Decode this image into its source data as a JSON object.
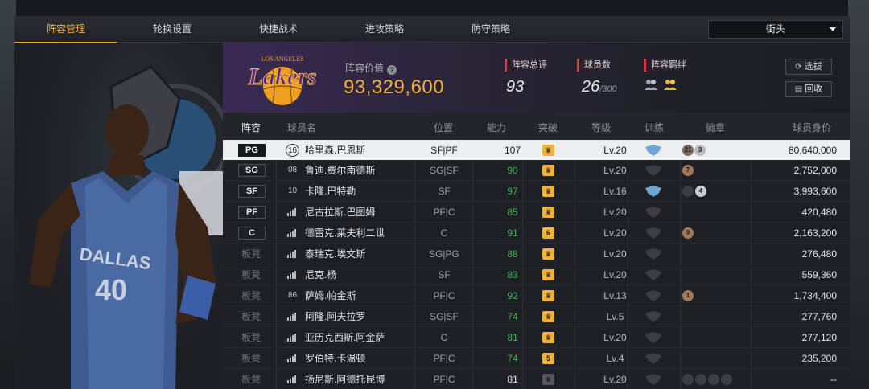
{
  "tabs": [
    {
      "label": "阵容管理",
      "active": true
    },
    {
      "label": "轮换设置",
      "active": false
    },
    {
      "label": "快捷战术",
      "active": false
    },
    {
      "label": "进攻策略",
      "active": false
    },
    {
      "label": "防守策略",
      "active": false
    }
  ],
  "dropdown": {
    "value": "街头"
  },
  "team": {
    "value_label": "阵容价值",
    "value": "93,329,600",
    "rating_label": "阵容总评",
    "rating": "93",
    "players_label": "球员数",
    "players": "26",
    "players_max": "/300",
    "bond_label": "阵容羁绊",
    "buttons": {
      "select": "选拔",
      "recycle": "回收"
    }
  },
  "columns": [
    "阵容",
    "球员名",
    "位置",
    "能力",
    "突破",
    "等级",
    "训练",
    "徽章",
    "球员身价"
  ],
  "rows": [
    {
      "slot": "PG",
      "number": "16",
      "name": "哈里森.巴恩斯",
      "position": "SF|PF",
      "ability": "107",
      "breakthrough": "",
      "level": "Lv.20",
      "salary": "80,640,000",
      "selected": true
    },
    {
      "slot": "SG",
      "number": "08",
      "name": "鲁迪.费尔南德斯",
      "position": "SG|SF",
      "ability": "90",
      "breakthrough": "",
      "level": "Lv.20",
      "salary": "2,752,000"
    },
    {
      "slot": "SF",
      "number": "10",
      "name": "卡隆.巴特勒",
      "position": "SF",
      "ability": "97",
      "breakthrough": "",
      "level": "Lv.16",
      "salary": "3,993,600"
    },
    {
      "slot": "PF",
      "number": "",
      "name": "尼古拉斯.巴图姆",
      "position": "PF|C",
      "ability": "85",
      "breakthrough": "",
      "level": "Lv.20",
      "salary": "420,480"
    },
    {
      "slot": "C",
      "number": "",
      "name": "德雷克.莱夫利二世",
      "position": "C",
      "ability": "91",
      "breakthrough": "6",
      "level": "Lv.20",
      "salary": "2,163,200"
    },
    {
      "slot": "板凳",
      "number": "",
      "name": "泰瑞克.埃文斯",
      "position": "SG|PG",
      "ability": "88",
      "breakthrough": "",
      "level": "Lv.20",
      "salary": "276,480"
    },
    {
      "slot": "板凳",
      "number": "",
      "name": "尼克.杨",
      "position": "SF",
      "ability": "83",
      "breakthrough": "",
      "level": "Lv.20",
      "salary": "559,360"
    },
    {
      "slot": "板凳",
      "number": "86",
      "name": "萨姆.帕金斯",
      "position": "PF|C",
      "ability": "92",
      "breakthrough": "",
      "level": "Lv.13",
      "salary": "1,734,400"
    },
    {
      "slot": "板凳",
      "number": "",
      "name": "阿隆.阿夫拉罗",
      "position": "SG|SF",
      "ability": "74",
      "breakthrough": "",
      "level": "Lv.5",
      "salary": "277,760"
    },
    {
      "slot": "板凳",
      "number": "",
      "name": "亚历克西斯.阿金萨",
      "position": "C",
      "ability": "81",
      "breakthrough": "",
      "level": "Lv.20",
      "salary": "277,120"
    },
    {
      "slot": "板凳",
      "number": "",
      "name": "罗伯特.卡温顿",
      "position": "PF|C",
      "ability": "74",
      "breakthrough": "5",
      "level": "Lv.4",
      "salary": "235,200"
    },
    {
      "slot": "板凳",
      "number": "",
      "name": "扬尼斯.阿德托昆博",
      "position": "PF|C",
      "ability": "81",
      "breakthrough": "",
      "level": "Lv.20",
      "salary": "--"
    }
  ],
  "badge_numbers": {
    "r0": [
      "21",
      "3"
    ],
    "r1": [
      "7"
    ],
    "r2": [
      "4"
    ],
    "r4": [
      "9"
    ],
    "r7": [
      "1"
    ]
  },
  "colors": {
    "accent": "#f0b23a",
    "green": "#3fb04e",
    "red": "#e03a3a"
  },
  "portrait": {
    "jersey_team": "DALLAS",
    "jersey_number": "40"
  },
  "logo": {
    "city": "LOS ANGELES",
    "name": "Lakers"
  }
}
